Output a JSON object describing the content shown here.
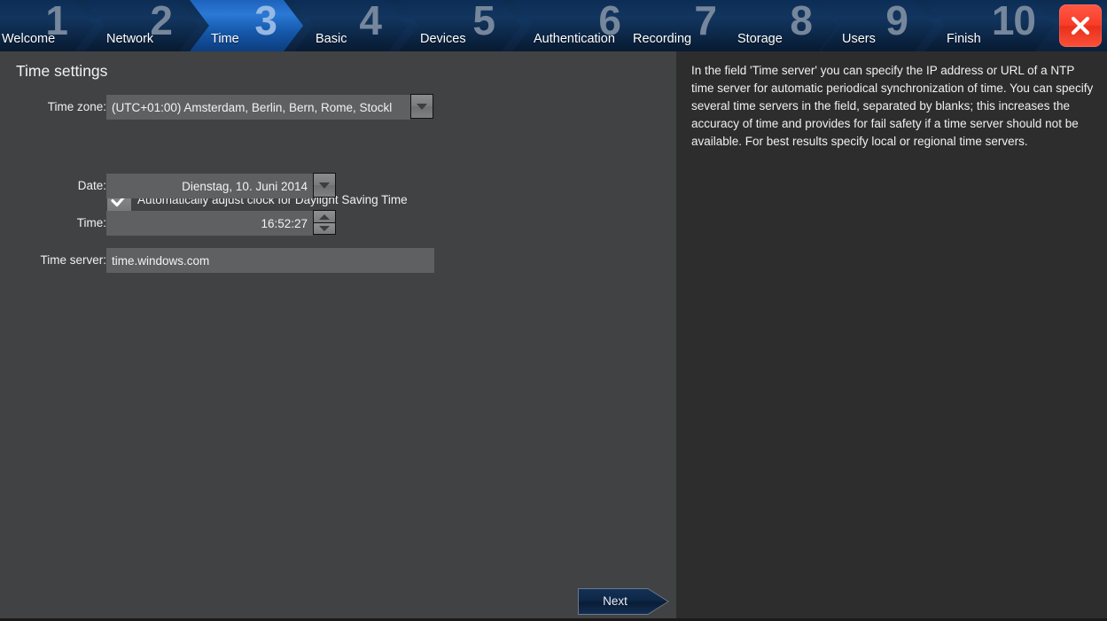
{
  "window": {
    "close_label": "Close",
    "close_icon": "close-x-icon",
    "accent_blue": "#2b79d6",
    "panel_bg": "#414244",
    "help_bg": "#2d2d2d",
    "close_red": "#f93c28"
  },
  "wizard": {
    "steps": [
      {
        "number": "1",
        "label": "Welcome",
        "active": false
      },
      {
        "number": "2",
        "label": "Network",
        "active": false
      },
      {
        "number": "3",
        "label": "Time",
        "active": true
      },
      {
        "number": "4",
        "label": "Basic",
        "active": false
      },
      {
        "number": "5",
        "label": "Devices",
        "active": false
      },
      {
        "number": "6",
        "label": "Authentication",
        "active": false
      },
      {
        "number": "7",
        "label": "Recording",
        "active": false
      },
      {
        "number": "8",
        "label": "Storage",
        "active": false
      },
      {
        "number": "9",
        "label": "Users",
        "active": false
      },
      {
        "number": "10",
        "label": "Finish",
        "active": false
      }
    ]
  },
  "page": {
    "title": "Time settings",
    "fields": {
      "timezone": {
        "label": "Time zone:",
        "value": "(UTC+01:00) Amsterdam, Berlin, Bern, Rome, Stockl",
        "dropdown_icon": "chevron-down-icon"
      },
      "dst": {
        "label": "Automatically adjust clock for Daylight Saving Time",
        "checked": true,
        "check_icon": "checkmark-icon"
      },
      "date": {
        "label": "Date:",
        "value": "Dienstag, 10. Juni 2014",
        "dropdown_icon": "chevron-down-icon"
      },
      "time": {
        "label": "Time:",
        "value": "16:52:27",
        "spinner_up_icon": "triangle-up-icon",
        "spinner_down_icon": "triangle-down-icon"
      },
      "timeserver": {
        "label": "Time server:",
        "value": "time.windows.com",
        "placeholder": "time.windows.com"
      }
    },
    "next_label": "Next"
  },
  "help": {
    "text": "In the field 'Time server' you can specify the IP address or URL of a NTP time server for automatic periodical synchronization of time. You can specify several time servers in the field, separated by blanks; this increases the accuracy of time and provides for fail safety if a time server should not be available. For best results specify local or regional time servers."
  }
}
